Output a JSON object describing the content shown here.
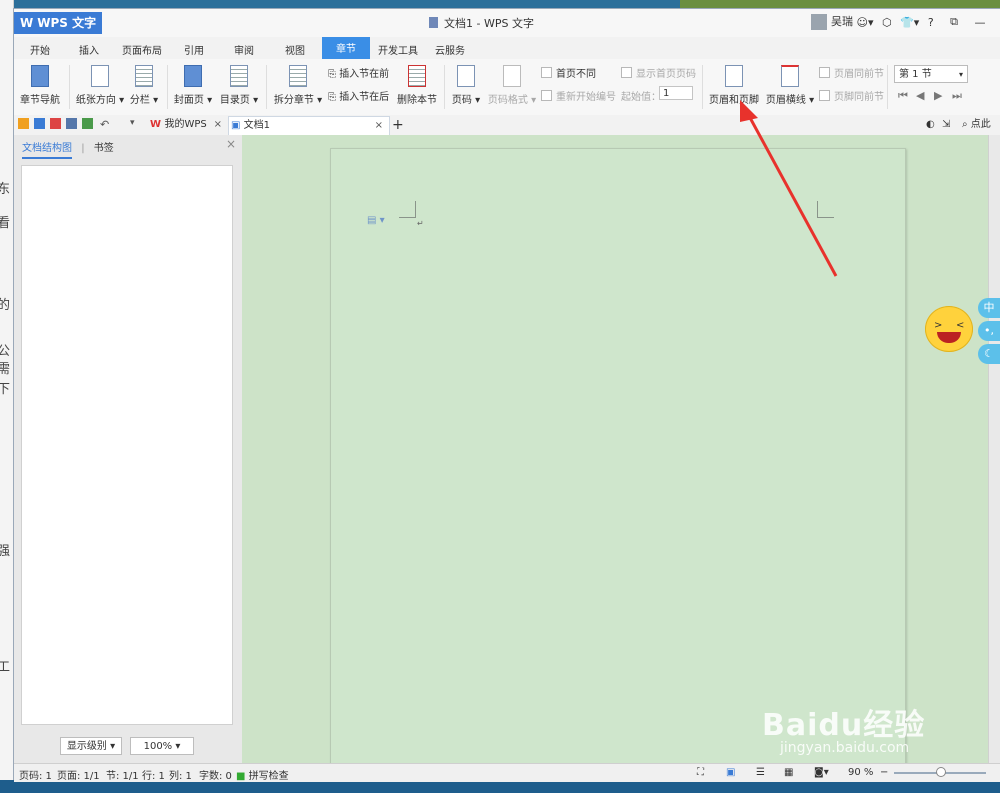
{
  "left_strip_chars": [
    "东",
    "看",
    "的",
    "公",
    "需",
    "下",
    "强",
    "工"
  ],
  "window": {
    "app_name": "WPS 文字",
    "title": "文档1 - WPS 文字",
    "user_name": "吴瑞",
    "help_label": "?"
  },
  "menu": {
    "tabs": [
      "开始",
      "插入",
      "页面布局",
      "引用",
      "审阅",
      "视图",
      "章节",
      "开发工具",
      "云服务"
    ],
    "active_tab": "章节"
  },
  "ribbon": {
    "chapter_nav": "章节导航",
    "paper_direction": "纸张方向",
    "columns": "分栏",
    "cover_page": "封面页",
    "toc_page": "目录页",
    "split_section": "拆分章节",
    "insert_before": "插入节在前",
    "insert_after": "插入节在后",
    "delete_section": "删除本节",
    "page_number": "页码",
    "page_format": "页码格式",
    "first_page_different": "首页不同",
    "show_first_page_number": "显示首页页码",
    "restart_numbering": "重新开始编号",
    "start_value_label": "起始值：",
    "start_value": "1",
    "header_footer": "页眉和页脚",
    "header_line": "页眉横线",
    "header_same_as_prev": "页眉同前节",
    "footer_same_as_prev": "页脚同前节",
    "section_select": "第 1 节"
  },
  "tabs": {
    "my_wps": "我的WPS",
    "doc1": "文档1",
    "add": "+",
    "search_hint": "点此"
  },
  "left_panel": {
    "tab_structure": "文档结构图",
    "tab_bookmarks": "书签",
    "level_select": "显示级别",
    "zoom_select": "100%"
  },
  "status": {
    "page": "页码: 1",
    "pages": "页面: 1/1",
    "section": "节: 1/1",
    "row": "行: 1",
    "col": "列: 1",
    "words": "字数: 0",
    "spell": "拼写检查",
    "zoom": "90 %"
  },
  "overlay": {
    "side_tool_1": "中",
    "watermark_brand": "Baidu经验",
    "watermark_url": "jingyan.baidu.com"
  },
  "colors": {
    "accent": "#3a8ee6",
    "doc_bg": "#cde3c8",
    "arrow": "#e8322c"
  }
}
